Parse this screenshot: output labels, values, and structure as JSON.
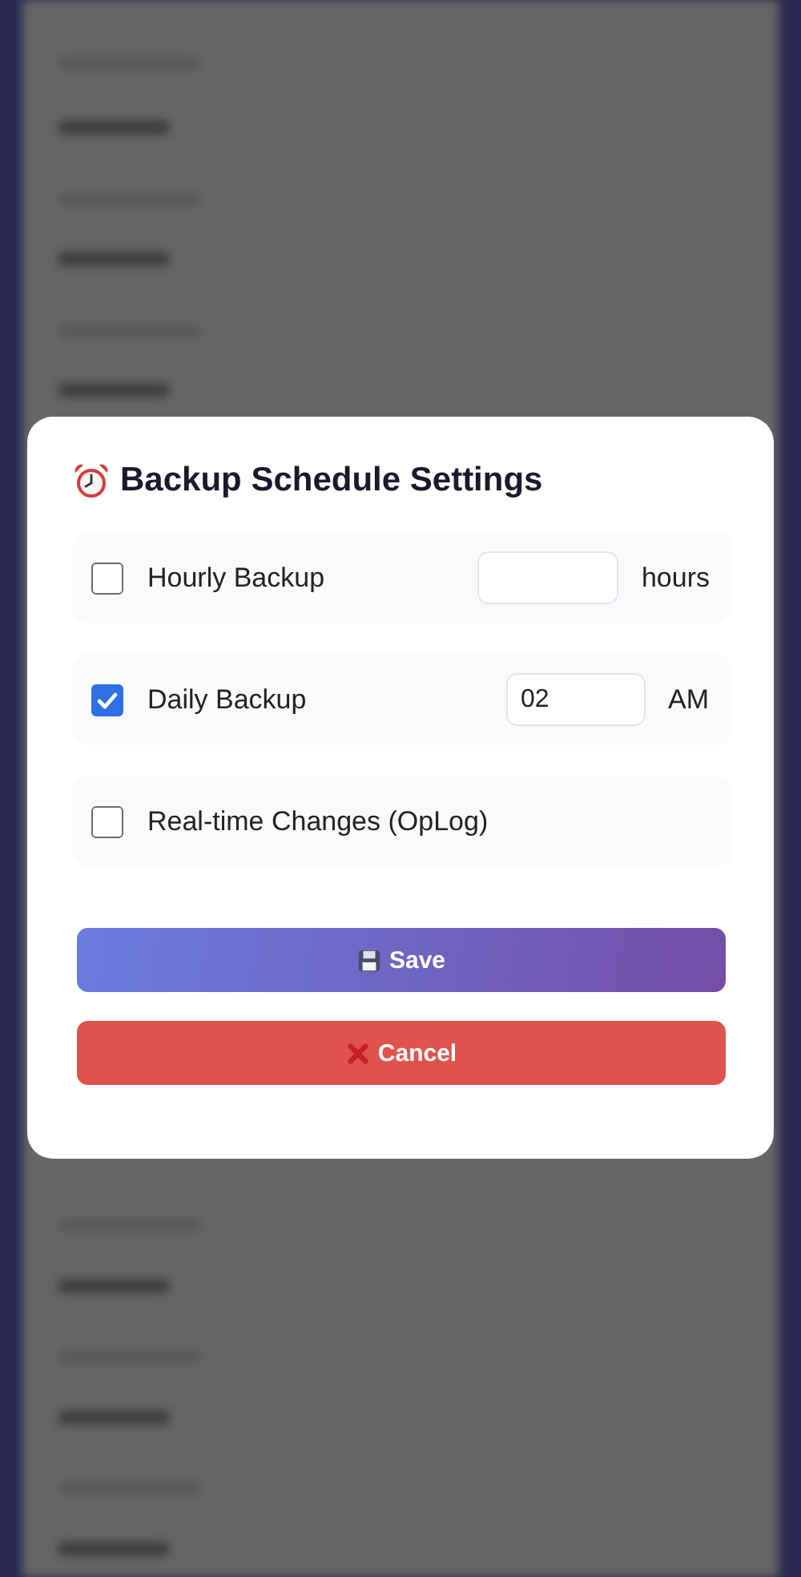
{
  "dialog": {
    "title": "Backup Schedule Settings",
    "options": [
      {
        "kind": "with_field",
        "label": "Hourly Backup",
        "checked": false,
        "unit": "hours"
      },
      {
        "kind": "with_field",
        "label": "Daily Backup",
        "checked": true,
        "value": "02",
        "unit": "AM"
      },
      {
        "kind": "plain",
        "label": "Real-time Changes (OpLog)",
        "checked": false
      }
    ],
    "buttons": [
      {
        "kind": "save",
        "label": "Save"
      },
      {
        "kind": "cancel",
        "label": "Cancel"
      }
    ]
  }
}
